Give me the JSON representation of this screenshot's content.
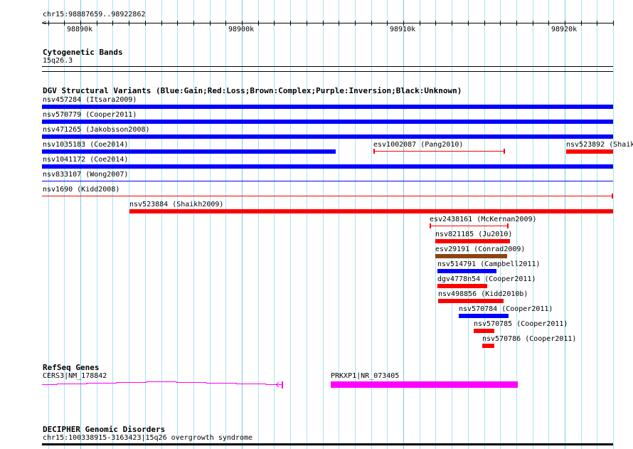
{
  "ruler": {
    "region": "chr15:98887659..98922862",
    "ticks": [
      "98890k",
      "98900k",
      "98910k",
      "98920k"
    ]
  },
  "tracks": {
    "cytoband": {
      "title": "Cytogenetic Bands",
      "band": "15q26.3"
    },
    "dgv": {
      "title": "DGV Structural Variants (Blue:Gain;Red:Loss;Brown:Complex;Purple:Inversion;Black:Unknown)",
      "colors": {
        "gain": "#0000ff",
        "loss": "#ff0000",
        "complex": "#8b4513"
      },
      "features": [
        {
          "label": "nsv457284 (Itsara2009)",
          "type": "gain"
        },
        {
          "label": "nsv570779 (Cooper2011)",
          "type": "gain"
        },
        {
          "label": "nsv471265 (Jakobsson2008)",
          "type": "gain"
        },
        {
          "label": "nsv1035183 (Coe2014)",
          "type": "gain"
        },
        {
          "label": "esv1002087 (Pang2010)",
          "type": "loss"
        },
        {
          "label": "nsv523892 (Shaik",
          "type": "loss"
        },
        {
          "label": "nsv1041172 (Coe2014)",
          "type": "gain"
        },
        {
          "label": "nsv833107 (Wong2007)",
          "type": "gain"
        },
        {
          "label": "nsv1690 (Kidd2008)",
          "type": "loss"
        },
        {
          "label": "nsv523884 (Shaikh2009)",
          "type": "loss"
        },
        {
          "label": "esv2438161 (McKernan2009)",
          "type": "loss"
        },
        {
          "label": "nsv821185 (Ju2010)",
          "type": "loss"
        },
        {
          "label": "esv29191 (Conrad2009)",
          "type": "complex"
        },
        {
          "label": "nsv514791 (Campbell2011)",
          "type": "gain"
        },
        {
          "label": "dgv4778n54 (Cooper2011)",
          "type": "loss"
        },
        {
          "label": "nsv498856 (Kidd2010b)",
          "type": "loss"
        },
        {
          "label": "nsv570784 (Cooper2011)",
          "type": "gain"
        },
        {
          "label": "nsv570785 (Cooper2011)",
          "type": "loss"
        },
        {
          "label": "nsv570786 (Cooper2011)",
          "type": "loss"
        }
      ]
    },
    "refseq": {
      "title": "RefSeq Genes",
      "genes": [
        {
          "label": "CERS3|NM_178842"
        },
        {
          "label": "PRKXP1|NR_073405"
        }
      ],
      "color": "#ff00ff"
    },
    "decipher": {
      "title": "DECIPHER Genomic Disorders",
      "label": "chr15:100338915-3163423|15q26 overgrowth syndrome"
    }
  }
}
